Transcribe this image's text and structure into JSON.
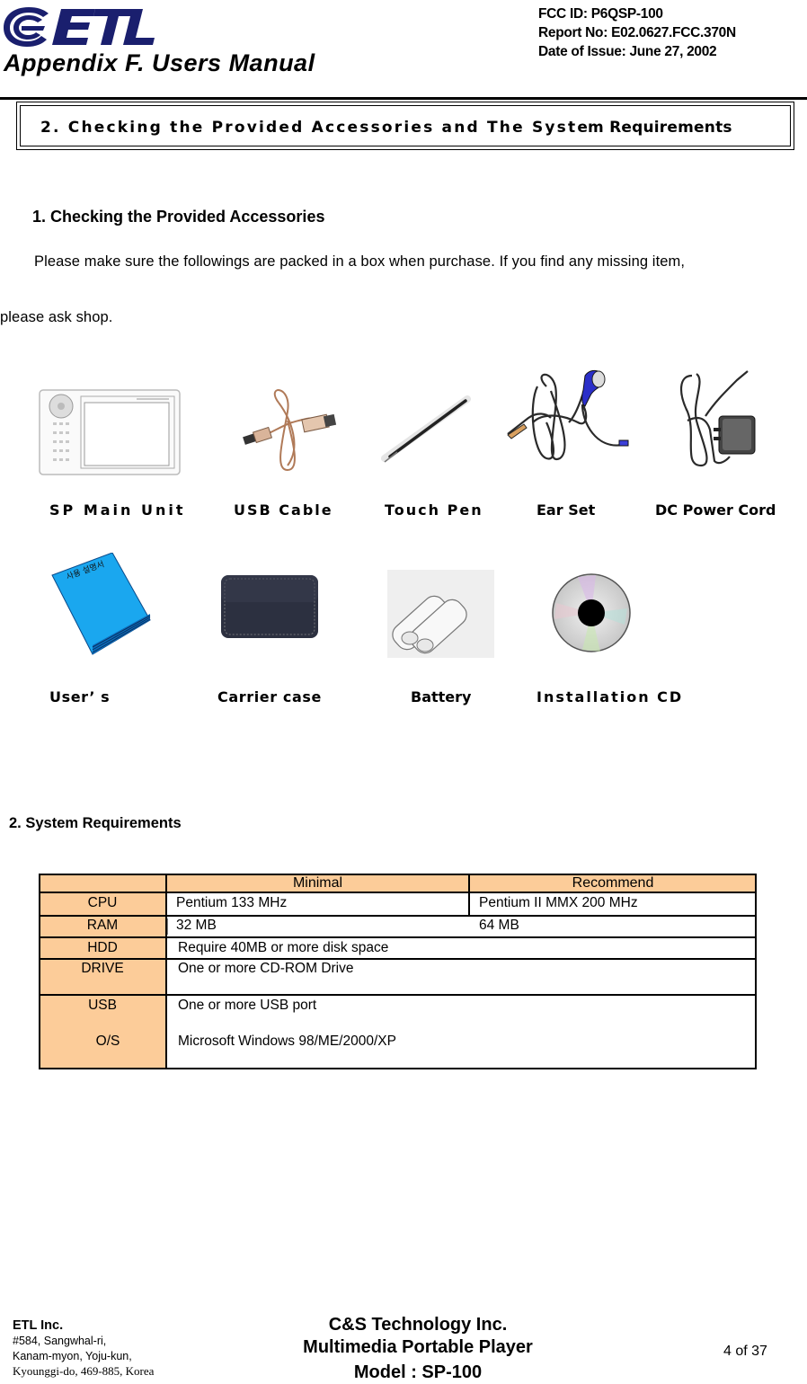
{
  "header": {
    "logo_text": "ETL",
    "title": "Appendix F.  Users Manual",
    "fcc_id": "FCC ID: P6QSP-100",
    "report_no": "Report No: E02.0627.FCC.370N",
    "date_of_issue": "Date of Issue: June 27, 2002"
  },
  "section": {
    "title_part1": "2. Checking the Provided Accessories and The Syst",
    "title_part2": "em Requirements"
  },
  "accessories": {
    "heading": "1.   Checking the Provided Accessories",
    "intro_line1": "Please make sure the followings are packed in a box when purchase. If you find any missing item,",
    "intro_line2": "please ask shop.",
    "items": [
      {
        "label": "SP Main Unit",
        "icon": "media-player-icon"
      },
      {
        "label": "USB Cable",
        "icon": "usb-cable-icon"
      },
      {
        "label": "Touch Pen",
        "icon": "stylus-icon"
      },
      {
        "label": "Ear Set",
        "icon": "earphone-icon"
      },
      {
        "label": "DC Power Cord",
        "icon": "power-adapter-icon"
      },
      {
        "label": "User’ s",
        "icon": "manual-book-icon",
        "book_text": "사용 설명서"
      },
      {
        "label": "Carrier case",
        "icon": "carrier-case-icon"
      },
      {
        "label": "Battery",
        "icon": "battery-icon"
      },
      {
        "label": "Installation CD",
        "icon": "cd-icon"
      }
    ]
  },
  "requirements": {
    "heading": "2. System Requirements",
    "columns": [
      "",
      "Minimal",
      "Recommend"
    ],
    "rows": [
      {
        "label": "CPU",
        "minimal": "Pentium 133 MHz",
        "recommend": "Pentium II MMX 200 MHz"
      },
      {
        "label": "RAM",
        "minimal": "32 MB",
        "recommend": "64 MB"
      },
      {
        "label": "HDD",
        "value": "Require 40MB or more disk space"
      },
      {
        "label": "DRIVE",
        "value": "One or more CD-ROM Drive"
      },
      {
        "label": "USB",
        "value": "One or more USB port"
      },
      {
        "label": "O/S",
        "value": "Microsoft Windows 98/ME/2000/XP"
      }
    ],
    "colors": {
      "label_bg": "#fccc99",
      "border": "#000000"
    }
  },
  "footer": {
    "company": "ETL Inc.",
    "address_line1": "#584, Sangwhal-ri,",
    "address_line2": "Kanam-myon, Yoju-kun,",
    "address_line3": "Kyounggi-do, 469-885, Korea",
    "manufacturer": "C&S Technology Inc.",
    "product": "Multimedia Portable Player",
    "model": "Model : SP-100",
    "page": "4 of 37"
  },
  "colors": {
    "logo_navy": "#1a1f6e",
    "book_blue": "#1aa7ef",
    "earphone_blue": "#2b2fc9"
  }
}
